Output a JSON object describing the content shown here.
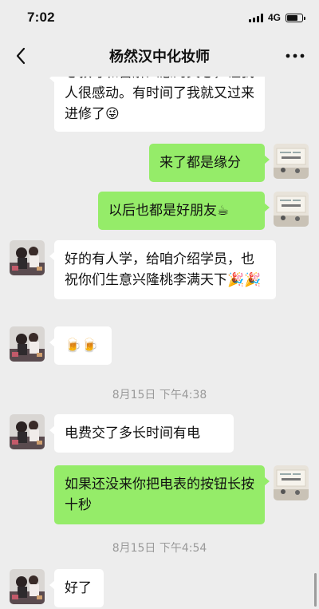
{
  "status": {
    "time": "7:02",
    "network": "4G",
    "battery_level": 0.8
  },
  "header": {
    "title": "杨然汉中化妆师"
  },
  "messages": {
    "m1": {
      "text": "心教导和雷解人意的关心，让我人很感动。有时间了我就又过来进修了",
      "emoji": "😜"
    },
    "m2": {
      "text": "来了都是缘分"
    },
    "m3": {
      "text": "以后也都是好朋友",
      "emoji": "☕"
    },
    "m4": {
      "text": "好的有人学，给咱介绍学员，也祝你们生意兴隆桃李满天下",
      "emoji": "🎉🎉"
    },
    "m5": {
      "emoji": "🍺🍺"
    },
    "t1": {
      "text": "8月15日 下午4:38"
    },
    "m6": {
      "text": "电费交了多长时间有电"
    },
    "m7": {
      "text": "如果还没来你把电表的按钮长按十秒"
    },
    "t2": {
      "text": "8月15日 下午4:54"
    },
    "m8": {
      "text": "好了"
    }
  },
  "colors": {
    "outgoing_bubble": "#95ec69",
    "incoming_bubble": "#ffffff",
    "background": "#ededed"
  },
  "icons": {
    "back": "chevron-left-icon",
    "more": "more-dots-icon"
  }
}
